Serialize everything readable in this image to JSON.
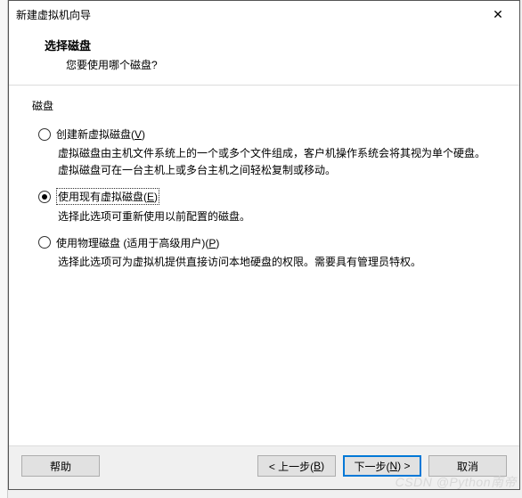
{
  "window": {
    "title": "新建虚拟机向导",
    "close_glyph": "✕"
  },
  "header": {
    "title": "选择磁盘",
    "subtitle": "您要使用哪个磁盘?"
  },
  "group": {
    "label": "磁盘"
  },
  "options": [
    {
      "label_pre": "创建新虚拟磁盘(",
      "hotkey": "V",
      "label_post": ")",
      "desc": "虚拟磁盘由主机文件系统上的一个或多个文件组成，客户机操作系统会将其视为单个硬盘。虚拟磁盘可在一台主机上或多台主机之间轻松复制或移动。",
      "checked": false
    },
    {
      "label_pre": "使用现有虚拟磁盘(",
      "hotkey": "E",
      "label_post": ")",
      "desc": "选择此选项可重新使用以前配置的磁盘。",
      "checked": true
    },
    {
      "label_pre": "使用物理磁盘 (适用于高级用户)(",
      "hotkey": "P",
      "label_post": ")",
      "desc": "选择此选项可为虚拟机提供直接访问本地硬盘的权限。需要具有管理员特权。",
      "checked": false
    }
  ],
  "buttons": {
    "help": "帮助",
    "back_pre": "< 上一步(",
    "back_hot": "B",
    "back_post": ")",
    "next_pre": "下一步(",
    "next_hot": "N",
    "next_post": ") >",
    "cancel": "取消"
  },
  "watermark": "CSDN @Python南帝"
}
